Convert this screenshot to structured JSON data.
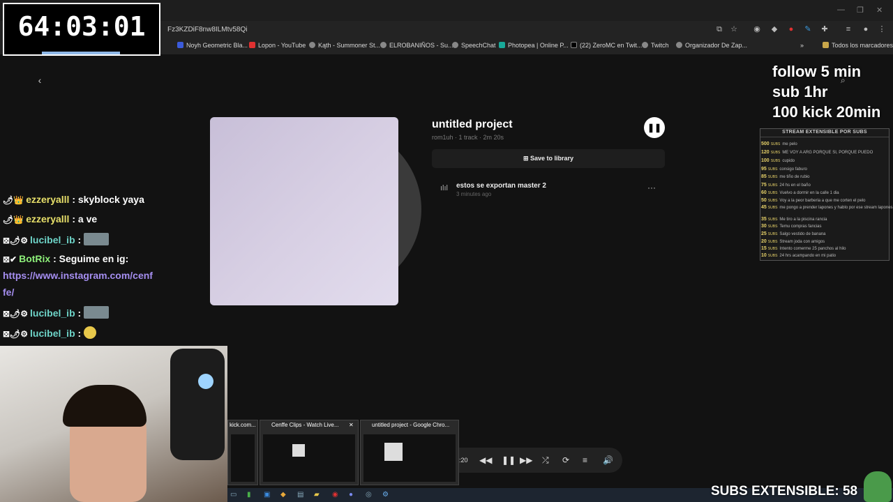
{
  "browser": {
    "url": "Fz3KZDiF8nw8ILMtv58Qi",
    "bookmarks": [
      {
        "label": "Noyh Geometric Bla...",
        "icon": "app-icon",
        "color": "#3b5bdb"
      },
      {
        "label": "Lopon - YouTube",
        "icon": "youtube-icon",
        "color": "#e03131"
      },
      {
        "label": "Kąth - Summoner St...",
        "icon": "globe-icon",
        "color": "#888888"
      },
      {
        "label": "ELROBANIÑOS - Su...",
        "icon": "globe-icon",
        "color": "#888888"
      },
      {
        "label": "SpeechChat",
        "icon": "globe-icon",
        "color": "#888888"
      },
      {
        "label": "Photopea | Online P...",
        "icon": "photopea-icon",
        "color": "#18a999"
      },
      {
        "label": "(22) ZeroMC en Twit...",
        "icon": "x-icon",
        "color": "#000000"
      },
      {
        "label": "Twitch",
        "icon": "globe-icon",
        "color": "#888888"
      },
      {
        "label": "Organizador De Zap...",
        "icon": "globe-icon",
        "color": "#888888"
      }
    ],
    "all_bookmarks": "Todos los marcadores",
    "more": "»"
  },
  "project": {
    "title": "untitled project",
    "meta": "rom1uh · 1 track · 2m 20s",
    "save_label": "Save to library",
    "track_name": "estos se exportan master 2",
    "track_time": "3 minutes ago"
  },
  "timer": "64:03:01",
  "overlay": {
    "follow_lines": [
      "follow 5 min",
      "sub 1hr",
      "100 kick 20min"
    ],
    "subs_title": "STREAM EXTENSIBLE POR SUBS",
    "subs_word": "SUBS",
    "subs": [
      {
        "n": "500",
        "t": "me pelo"
      },
      {
        "n": "120",
        "t": "ME VOY A ARG PORQUE SI, PORQUE PUEDO"
      },
      {
        "n": "100",
        "t": "cupido"
      },
      {
        "n": "95",
        "t": "consigo faburo"
      },
      {
        "n": "85",
        "t": "me tiño de rubio"
      },
      {
        "n": "75",
        "t": "24 hs en el baño"
      },
      {
        "n": "60",
        "t": "Vuelvo a dormir en la calle 1 dia"
      },
      {
        "n": "50",
        "t": "Voy a la peor barberia a que me corten el pelo"
      },
      {
        "n": "45",
        "t": "me pongo a prender lapones y hablo por ese stream lapones"
      },
      {
        "n": "35",
        "t": "Me tiro a la piscina rancia"
      },
      {
        "n": "30",
        "t": "Temu compras fancias"
      },
      {
        "n": "25",
        "t": "Salgo vestido de banana"
      },
      {
        "n": "20",
        "t": "Stream joda con amigos"
      },
      {
        "n": "15",
        "t": "Intento comerme 25 panchos al hilo"
      },
      {
        "n": "10",
        "t": "24 hrs acampando en mi patio"
      }
    ],
    "subs_extensible": "SUBS EXTENSIBLE: 58"
  },
  "chat": [
    {
      "user": "ezzeryalll",
      "msg": " : skyblock yaya",
      "style": "y"
    },
    {
      "user": "ezzeryalll",
      "msg": " : a ve",
      "style": "y"
    },
    {
      "user": "lucibel_ib",
      "msg": " : ",
      "style": "c",
      "emote": true
    },
    {
      "user": "BotRix",
      "msg": " : Seguime en ig:",
      "style": "g"
    },
    {
      "link1": "https://www.instagram.com/cenf",
      "link2": "fe/"
    },
    {
      "user": "lucibel_ib",
      "msg": " : ",
      "style": "c",
      "emote": true
    },
    {
      "user": "lucibel_ib",
      "msg": " : ",
      "style": "c",
      "emote": true
    }
  ],
  "taskbar_previews": [
    {
      "label": "kick.com..."
    },
    {
      "label": "Cenffe Clips - Watch Live..."
    },
    {
      "label": "untitled project - Google Chro..."
    }
  ],
  "player": {
    "time": ":20"
  }
}
